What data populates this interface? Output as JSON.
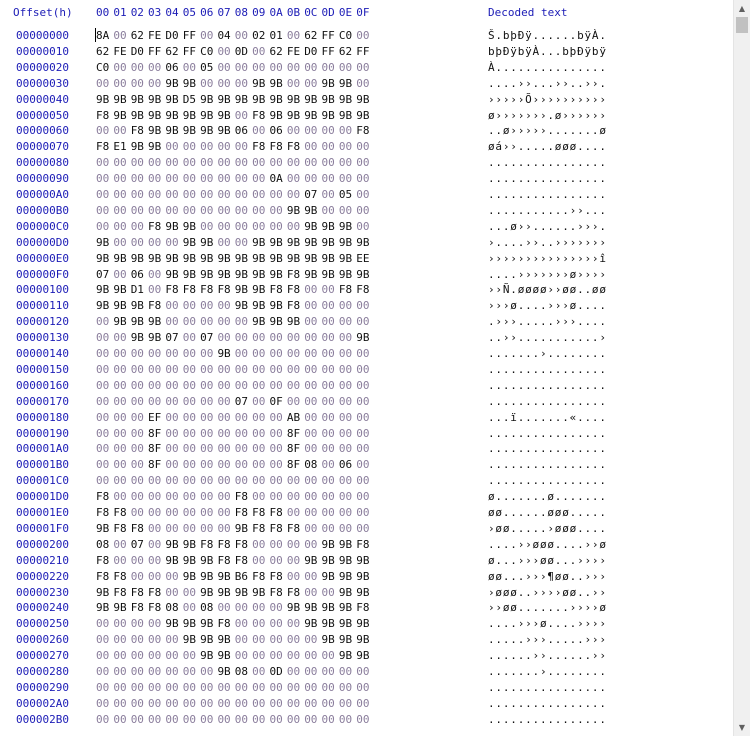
{
  "header": {
    "offset_label": "Offset(h)",
    "columns": [
      "00",
      "01",
      "02",
      "03",
      "04",
      "05",
      "06",
      "07",
      "08",
      "09",
      "0A",
      "0B",
      "0C",
      "0D",
      "0E",
      "0F"
    ],
    "decoded_label": "Decoded text"
  },
  "rows": [
    {
      "offset": "00000000",
      "bytes": [
        "8A",
        "00",
        "62",
        "FE",
        "D0",
        "FF",
        "00",
        "04",
        "00",
        "02",
        "01",
        "00",
        "62",
        "FF",
        "C0",
        "00"
      ],
      "decoded": "Š.bþÐÿ......bÿÀ."
    },
    {
      "offset": "00000010",
      "bytes": [
        "62",
        "FE",
        "D0",
        "FF",
        "62",
        "FF",
        "C0",
        "00",
        "0D",
        "00",
        "62",
        "FE",
        "D0",
        "FF",
        "62",
        "FF"
      ],
      "decoded": "bþÐÿbÿÀ...bþÐÿbÿ"
    },
    {
      "offset": "00000020",
      "bytes": [
        "C0",
        "00",
        "00",
        "00",
        "06",
        "00",
        "05",
        "00",
        "00",
        "00",
        "00",
        "00",
        "00",
        "00",
        "00",
        "00"
      ],
      "decoded": "À..............."
    },
    {
      "offset": "00000030",
      "bytes": [
        "00",
        "00",
        "00",
        "00",
        "9B",
        "9B",
        "00",
        "00",
        "00",
        "9B",
        "9B",
        "00",
        "00",
        "9B",
        "9B",
        "00"
      ],
      "decoded": "....››...››..››."
    },
    {
      "offset": "00000040",
      "bytes": [
        "9B",
        "9B",
        "9B",
        "9B",
        "9B",
        "D5",
        "9B",
        "9B",
        "9B",
        "9B",
        "9B",
        "9B",
        "9B",
        "9B",
        "9B",
        "9B"
      ],
      "decoded": "›››››Õ››››››››››"
    },
    {
      "offset": "00000050",
      "bytes": [
        "F8",
        "9B",
        "9B",
        "9B",
        "9B",
        "9B",
        "9B",
        "9B",
        "00",
        "F8",
        "9B",
        "9B",
        "9B",
        "9B",
        "9B",
        "9B"
      ],
      "decoded": "ø›››››››.ø››››››"
    },
    {
      "offset": "00000060",
      "bytes": [
        "00",
        "00",
        "F8",
        "9B",
        "9B",
        "9B",
        "9B",
        "9B",
        "06",
        "00",
        "06",
        "00",
        "00",
        "00",
        "00",
        "F8"
      ],
      "decoded": "..ø›››››.......ø"
    },
    {
      "offset": "00000070",
      "bytes": [
        "F8",
        "E1",
        "9B",
        "9B",
        "00",
        "00",
        "00",
        "00",
        "00",
        "F8",
        "F8",
        "F8",
        "00",
        "00",
        "00",
        "00"
      ],
      "decoded": "øá››.....øøø...."
    },
    {
      "offset": "00000080",
      "bytes": [
        "00",
        "00",
        "00",
        "00",
        "00",
        "00",
        "00",
        "00",
        "00",
        "00",
        "00",
        "00",
        "00",
        "00",
        "00",
        "00"
      ],
      "decoded": "................"
    },
    {
      "offset": "00000090",
      "bytes": [
        "00",
        "00",
        "00",
        "00",
        "00",
        "00",
        "00",
        "00",
        "00",
        "00",
        "0A",
        "00",
        "00",
        "00",
        "00",
        "00"
      ],
      "decoded": "................"
    },
    {
      "offset": "000000A0",
      "bytes": [
        "00",
        "00",
        "00",
        "00",
        "00",
        "00",
        "00",
        "00",
        "00",
        "00",
        "00",
        "00",
        "07",
        "00",
        "05",
        "00"
      ],
      "decoded": "................"
    },
    {
      "offset": "000000B0",
      "bytes": [
        "00",
        "00",
        "00",
        "00",
        "00",
        "00",
        "00",
        "00",
        "00",
        "00",
        "00",
        "9B",
        "9B",
        "00",
        "00",
        "00"
      ],
      "decoded": "...........››..."
    },
    {
      "offset": "000000C0",
      "bytes": [
        "00",
        "00",
        "00",
        "F8",
        "9B",
        "9B",
        "00",
        "00",
        "00",
        "00",
        "00",
        "00",
        "9B",
        "9B",
        "9B",
        "00"
      ],
      "decoded": "...ø››......›››."
    },
    {
      "offset": "000000D0",
      "bytes": [
        "9B",
        "00",
        "00",
        "00",
        "00",
        "9B",
        "9B",
        "00",
        "00",
        "9B",
        "9B",
        "9B",
        "9B",
        "9B",
        "9B",
        "9B"
      ],
      "decoded": "›....››..›››››››"
    },
    {
      "offset": "000000E0",
      "bytes": [
        "9B",
        "9B",
        "9B",
        "9B",
        "9B",
        "9B",
        "9B",
        "9B",
        "9B",
        "9B",
        "9B",
        "9B",
        "9B",
        "9B",
        "9B",
        "EE"
      ],
      "decoded": "›››››››››››››››î"
    },
    {
      "offset": "000000F0",
      "bytes": [
        "07",
        "00",
        "06",
        "00",
        "9B",
        "9B",
        "9B",
        "9B",
        "9B",
        "9B",
        "9B",
        "F8",
        "9B",
        "9B",
        "9B",
        "9B"
      ],
      "decoded": "....›››››››ø››››"
    },
    {
      "offset": "00000100",
      "bytes": [
        "9B",
        "9B",
        "D1",
        "00",
        "F8",
        "F8",
        "F8",
        "F8",
        "9B",
        "9B",
        "F8",
        "F8",
        "00",
        "00",
        "F8",
        "F8"
      ],
      "decoded": "››Ñ.øøøø››øø..øø"
    },
    {
      "offset": "00000110",
      "bytes": [
        "9B",
        "9B",
        "9B",
        "F8",
        "00",
        "00",
        "00",
        "00",
        "9B",
        "9B",
        "9B",
        "F8",
        "00",
        "00",
        "00",
        "00"
      ],
      "decoded": "›››ø....›››ø...."
    },
    {
      "offset": "00000120",
      "bytes": [
        "00",
        "9B",
        "9B",
        "9B",
        "00",
        "00",
        "00",
        "00",
        "00",
        "9B",
        "9B",
        "9B",
        "00",
        "00",
        "00",
        "00"
      ],
      "decoded": ".›››.....›››...."
    },
    {
      "offset": "00000130",
      "bytes": [
        "00",
        "00",
        "9B",
        "9B",
        "07",
        "00",
        "07",
        "00",
        "00",
        "00",
        "00",
        "00",
        "00",
        "00",
        "00",
        "9B"
      ],
      "decoded": "..››...........›"
    },
    {
      "offset": "00000140",
      "bytes": [
        "00",
        "00",
        "00",
        "00",
        "00",
        "00",
        "00",
        "9B",
        "00",
        "00",
        "00",
        "00",
        "00",
        "00",
        "00",
        "00"
      ],
      "decoded": ".......›........"
    },
    {
      "offset": "00000150",
      "bytes": [
        "00",
        "00",
        "00",
        "00",
        "00",
        "00",
        "00",
        "00",
        "00",
        "00",
        "00",
        "00",
        "00",
        "00",
        "00",
        "00"
      ],
      "decoded": "................"
    },
    {
      "offset": "00000160",
      "bytes": [
        "00",
        "00",
        "00",
        "00",
        "00",
        "00",
        "00",
        "00",
        "00",
        "00",
        "00",
        "00",
        "00",
        "00",
        "00",
        "00"
      ],
      "decoded": "................"
    },
    {
      "offset": "00000170",
      "bytes": [
        "00",
        "00",
        "00",
        "00",
        "00",
        "00",
        "00",
        "00",
        "07",
        "00",
        "0F",
        "00",
        "00",
        "00",
        "00",
        "00"
      ],
      "decoded": "................"
    },
    {
      "offset": "00000180",
      "bytes": [
        "00",
        "00",
        "00",
        "EF",
        "00",
        "00",
        "00",
        "00",
        "00",
        "00",
        "00",
        "AB",
        "00",
        "00",
        "00",
        "00"
      ],
      "decoded": "...ï.......«...."
    },
    {
      "offset": "00000190",
      "bytes": [
        "00",
        "00",
        "00",
        "8F",
        "00",
        "00",
        "00",
        "00",
        "00",
        "00",
        "00",
        "8F",
        "00",
        "00",
        "00",
        "00"
      ],
      "decoded": "................"
    },
    {
      "offset": "000001A0",
      "bytes": [
        "00",
        "00",
        "00",
        "8F",
        "00",
        "00",
        "00",
        "00",
        "00",
        "00",
        "00",
        "8F",
        "00",
        "00",
        "00",
        "00"
      ],
      "decoded": "................"
    },
    {
      "offset": "000001B0",
      "bytes": [
        "00",
        "00",
        "00",
        "8F",
        "00",
        "00",
        "00",
        "00",
        "00",
        "00",
        "00",
        "8F",
        "08",
        "00",
        "06",
        "00"
      ],
      "decoded": "................"
    },
    {
      "offset": "000001C0",
      "bytes": [
        "00",
        "00",
        "00",
        "00",
        "00",
        "00",
        "00",
        "00",
        "00",
        "00",
        "00",
        "00",
        "00",
        "00",
        "00",
        "00"
      ],
      "decoded": "................"
    },
    {
      "offset": "000001D0",
      "bytes": [
        "F8",
        "00",
        "00",
        "00",
        "00",
        "00",
        "00",
        "00",
        "F8",
        "00",
        "00",
        "00",
        "00",
        "00",
        "00",
        "00"
      ],
      "decoded": "ø.......ø......."
    },
    {
      "offset": "000001E0",
      "bytes": [
        "F8",
        "F8",
        "00",
        "00",
        "00",
        "00",
        "00",
        "00",
        "F8",
        "F8",
        "F8",
        "00",
        "00",
        "00",
        "00",
        "00"
      ],
      "decoded": "øø......øøø....."
    },
    {
      "offset": "000001F0",
      "bytes": [
        "9B",
        "F8",
        "F8",
        "00",
        "00",
        "00",
        "00",
        "00",
        "9B",
        "F8",
        "F8",
        "F8",
        "00",
        "00",
        "00",
        "00"
      ],
      "decoded": "›øø.....›øøø...."
    },
    {
      "offset": "00000200",
      "bytes": [
        "08",
        "00",
        "07",
        "00",
        "9B",
        "9B",
        "F8",
        "F8",
        "F8",
        "00",
        "00",
        "00",
        "00",
        "9B",
        "9B",
        "F8"
      ],
      "decoded": "....››øøø....››ø"
    },
    {
      "offset": "00000210",
      "bytes": [
        "F8",
        "00",
        "00",
        "00",
        "9B",
        "9B",
        "9B",
        "F8",
        "F8",
        "00",
        "00",
        "00",
        "9B",
        "9B",
        "9B",
        "9B"
      ],
      "decoded": "ø...›››øø...››››"
    },
    {
      "offset": "00000220",
      "bytes": [
        "F8",
        "F8",
        "00",
        "00",
        "00",
        "9B",
        "9B",
        "9B",
        "B6",
        "F8",
        "F8",
        "00",
        "00",
        "9B",
        "9B",
        "9B"
      ],
      "decoded": "øø...›››¶øø..›››"
    },
    {
      "offset": "00000230",
      "bytes": [
        "9B",
        "F8",
        "F8",
        "F8",
        "00",
        "00",
        "9B",
        "9B",
        "9B",
        "9B",
        "F8",
        "F8",
        "00",
        "00",
        "9B",
        "9B"
      ],
      "decoded": "›øøø..››››øø..››"
    },
    {
      "offset": "00000240",
      "bytes": [
        "9B",
        "9B",
        "F8",
        "F8",
        "08",
        "00",
        "08",
        "00",
        "00",
        "00",
        "00",
        "9B",
        "9B",
        "9B",
        "9B",
        "F8"
      ],
      "decoded": "››øø.......››››ø"
    },
    {
      "offset": "00000250",
      "bytes": [
        "00",
        "00",
        "00",
        "00",
        "9B",
        "9B",
        "9B",
        "F8",
        "00",
        "00",
        "00",
        "00",
        "9B",
        "9B",
        "9B",
        "9B"
      ],
      "decoded": "....›››ø....››››"
    },
    {
      "offset": "00000260",
      "bytes": [
        "00",
        "00",
        "00",
        "00",
        "00",
        "9B",
        "9B",
        "9B",
        "00",
        "00",
        "00",
        "00",
        "00",
        "9B",
        "9B",
        "9B"
      ],
      "decoded": ".....›››.....›››"
    },
    {
      "offset": "00000270",
      "bytes": [
        "00",
        "00",
        "00",
        "00",
        "00",
        "00",
        "9B",
        "9B",
        "00",
        "00",
        "00",
        "00",
        "00",
        "00",
        "9B",
        "9B"
      ],
      "decoded": "......››......››"
    },
    {
      "offset": "00000280",
      "bytes": [
        "00",
        "00",
        "00",
        "00",
        "00",
        "00",
        "00",
        "9B",
        "08",
        "00",
        "0D",
        "00",
        "00",
        "00",
        "00",
        "00"
      ],
      "decoded": ".......›........"
    },
    {
      "offset": "00000290",
      "bytes": [
        "00",
        "00",
        "00",
        "00",
        "00",
        "00",
        "00",
        "00",
        "00",
        "00",
        "00",
        "00",
        "00",
        "00",
        "00",
        "00"
      ],
      "decoded": "................"
    },
    {
      "offset": "000002A0",
      "bytes": [
        "00",
        "00",
        "00",
        "00",
        "00",
        "00",
        "00",
        "00",
        "00",
        "00",
        "00",
        "00",
        "00",
        "00",
        "00",
        "00"
      ],
      "decoded": "................"
    },
    {
      "offset": "000002B0",
      "bytes": [
        "00",
        "00",
        "00",
        "00",
        "00",
        "00",
        "00",
        "00",
        "00",
        "00",
        "00",
        "00",
        "00",
        "00",
        "00",
        "00"
      ],
      "decoded": "................"
    }
  ]
}
